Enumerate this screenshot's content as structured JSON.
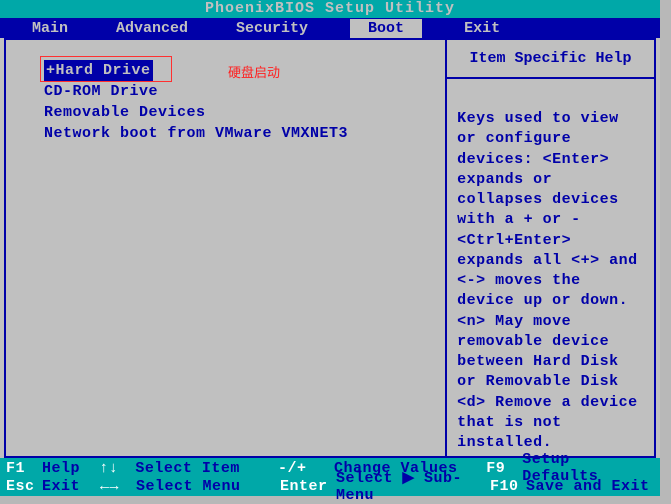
{
  "title": "PhoenixBIOS Setup Utility",
  "menu": {
    "items": [
      "Main",
      "Advanced",
      "Security",
      "Boot",
      "Exit"
    ],
    "selected": "Boot"
  },
  "boot": {
    "items": [
      {
        "label": "+Hard Drive",
        "selected": true
      },
      {
        "label": "CD-ROM Drive",
        "selected": false
      },
      {
        "label": "Removable Devices",
        "selected": false
      },
      {
        "label": "Network boot from VMware VMXNET3",
        "selected": false
      }
    ]
  },
  "annotation": "硬盘启动",
  "help": {
    "header": "Item Specific Help",
    "body": "Keys used to view or configure devices:\n<Enter> expands or collapses devices with a + or -\n<Ctrl+Enter> expands all\n<+> and <-> moves the device up or down.\n<n> May move removable device between Hard Disk or Removable Disk\n<d> Remove a device that is not installed."
  },
  "footer": {
    "r1": [
      {
        "key": "F1",
        "label": "Help"
      },
      {
        "key": "↑↓",
        "label": "Select Item"
      },
      {
        "key": "-/+",
        "label": "Change Values"
      },
      {
        "key": "F9",
        "label": "Setup Defaults"
      }
    ],
    "r2": [
      {
        "key": "Esc",
        "label": "Exit"
      },
      {
        "key": "←→",
        "label": "Select Menu"
      },
      {
        "key": "Enter",
        "label": "Select ▶ Sub-Menu"
      },
      {
        "key": "F10",
        "label": "Save and Exit"
      }
    ]
  },
  "colors": {
    "teal": "#00a8a8",
    "blue": "#0000a8",
    "gray": "#c0c0c0"
  }
}
